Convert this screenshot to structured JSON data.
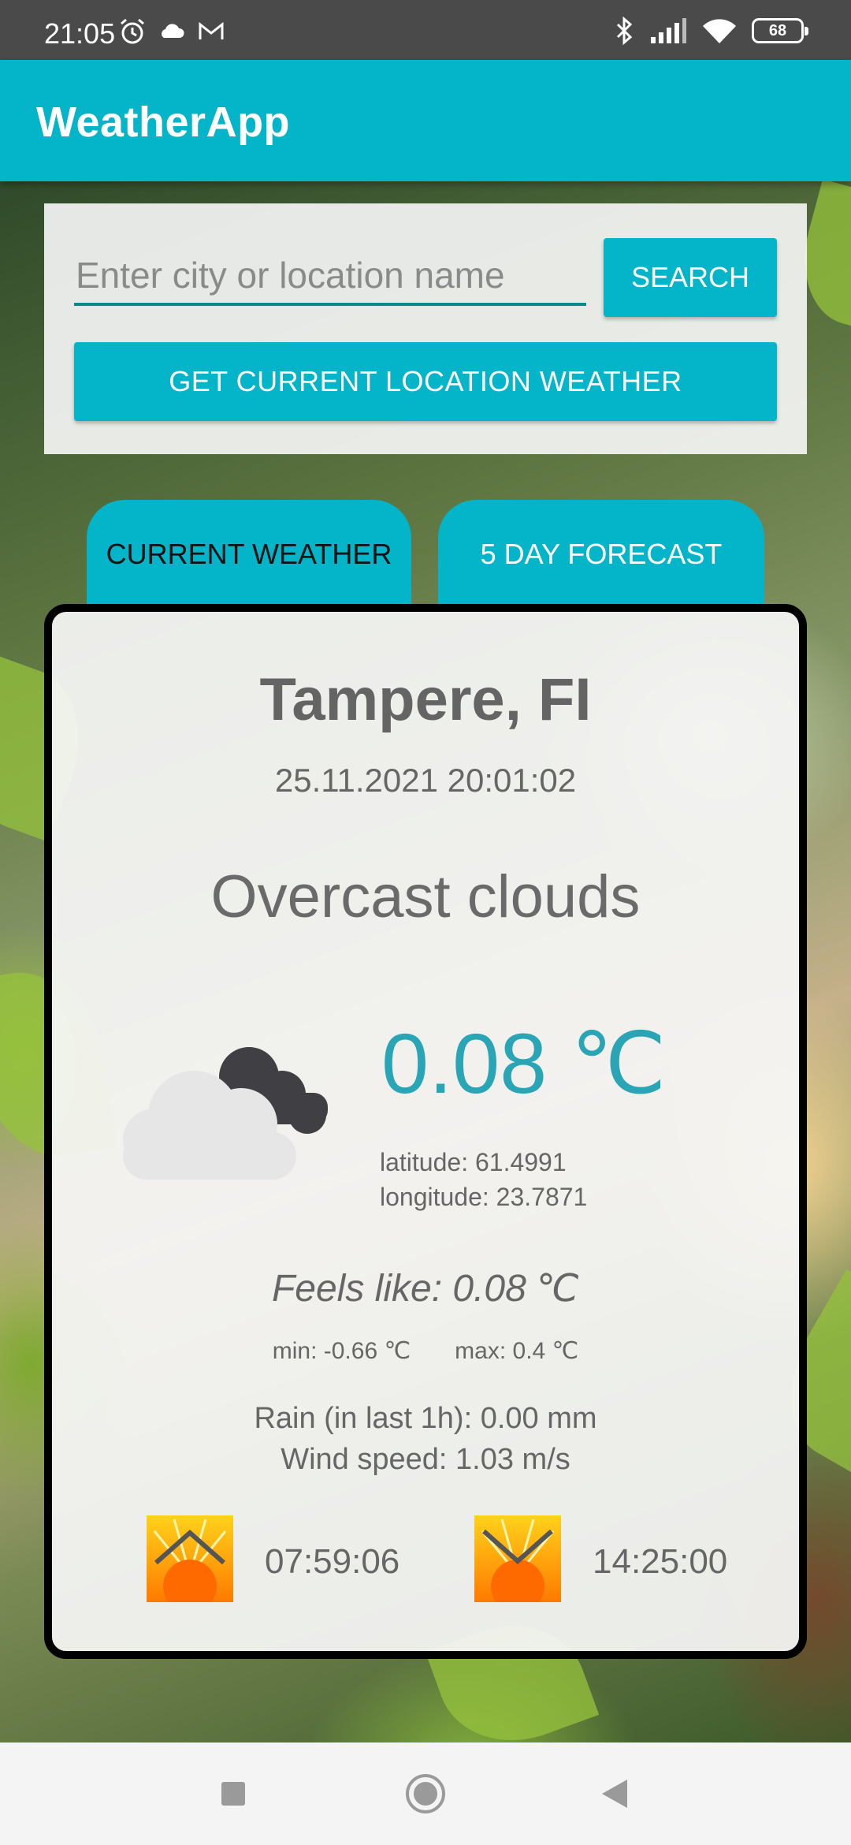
{
  "status_bar": {
    "time": "21:05",
    "battery": "68",
    "icons": [
      "alarm-icon",
      "cloud-icon",
      "gmail-icon",
      "bluetooth-icon",
      "signal-icon",
      "wifi-icon",
      "battery-icon"
    ]
  },
  "app_bar": {
    "title": "WeatherApp"
  },
  "search": {
    "placeholder": "Enter city or location name",
    "value": "",
    "button_label": "SEARCH",
    "location_button_label": "GET CURRENT LOCATION WEATHER"
  },
  "tabs": [
    {
      "label": "CURRENT WEATHER",
      "selected": true
    },
    {
      "label": "5 DAY FORECAST",
      "selected": false
    }
  ],
  "weather": {
    "city": "Tampere, FI",
    "datetime": "25.11.2021 20:01:02",
    "description": "Overcast clouds",
    "icon": "overcast-clouds-icon",
    "temperature": "0.08 ℃",
    "latitude": "latitude: 61.4991",
    "longitude": "longitude: 23.7871",
    "feels_like": "Feels like: 0.08 ℃",
    "min": "min: -0.66 ℃",
    "max": "max: 0.4 ℃",
    "rain": "Rain (in last 1h): 0.00 mm",
    "wind": "Wind speed: 1.03 m/s",
    "sunrise": "07:59:06",
    "sunset": "14:25:00"
  },
  "colors": {
    "accent": "#04b4c9",
    "temperature": "#2aa5b5",
    "text": "#666666"
  },
  "nav_bar": {
    "icons": [
      "recent-apps-icon",
      "home-icon",
      "back-icon"
    ]
  }
}
